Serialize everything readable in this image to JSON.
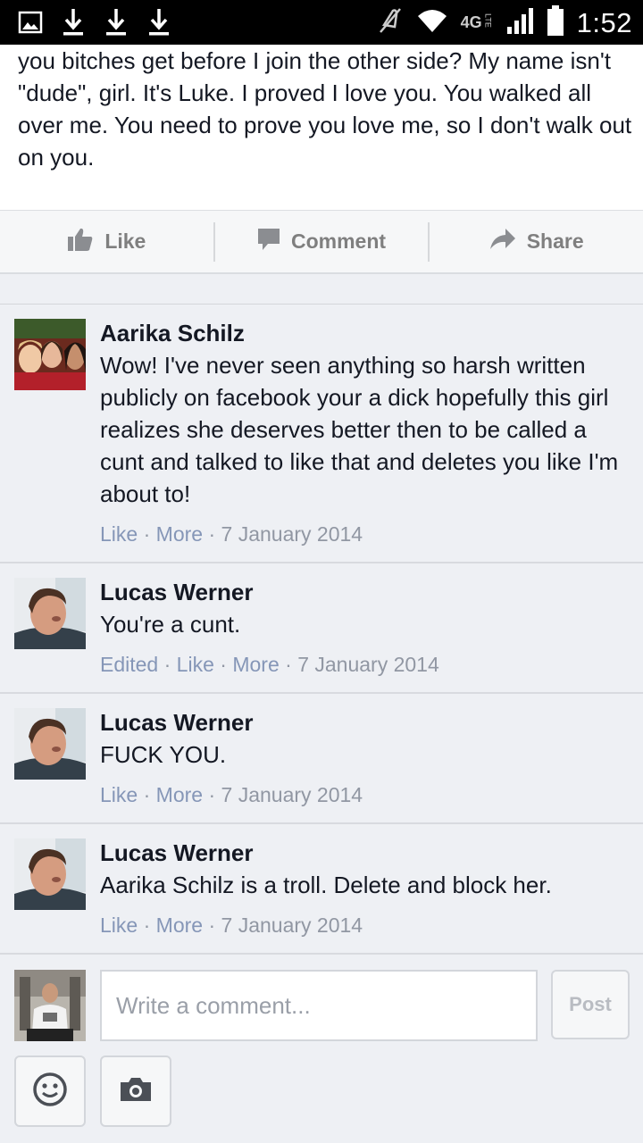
{
  "status_bar": {
    "left_icons": [
      "image-icon",
      "download-icon",
      "download-icon",
      "download-icon"
    ],
    "right_icons": [
      "mute-icon",
      "wifi-icon",
      "lte-icon",
      "signal-icon",
      "battery-icon"
    ],
    "network": "4G",
    "lte": "LTE",
    "time": "1:52"
  },
  "post": {
    "text": "you bitches get before I join the other side? My name isn't \"dude\", girl. It's Luke. I proved I love you. You walked all over me. You need to prove you love me, so I don't walk out on you."
  },
  "actions": {
    "like_label": "Like",
    "comment_label": "Comment",
    "share_label": "Share"
  },
  "comments": [
    {
      "author": "Aarika Schilz",
      "text": "Wow! I've never seen anything so harsh written publicly on facebook your a dick hopefully this girl realizes she deserves better then to be called a cunt and talked to like that and deletes you like I'm about to!",
      "edited": "",
      "like": "Like",
      "more": "More",
      "date": "7 January 2014"
    },
    {
      "author": "Lucas Werner",
      "text": "You're a cunt.",
      "edited": "Edited",
      "like": "Like",
      "more": "More",
      "date": "7 January 2014"
    },
    {
      "author": "Lucas Werner",
      "text": "FUCK YOU.",
      "edited": "",
      "like": "Like",
      "more": "More",
      "date": "7 January 2014"
    },
    {
      "author": "Lucas Werner",
      "text": "Aarika Schilz is a troll. Delete and block her.",
      "edited": "",
      "like": "Like",
      "more": "More",
      "date": "7 January 2014"
    }
  ],
  "composer": {
    "placeholder": "Write a comment...",
    "post_label": "Post"
  },
  "colors": {
    "link_meta": "#8596b7",
    "background": "#eef0f4",
    "action_text": "#7f7f7f"
  }
}
